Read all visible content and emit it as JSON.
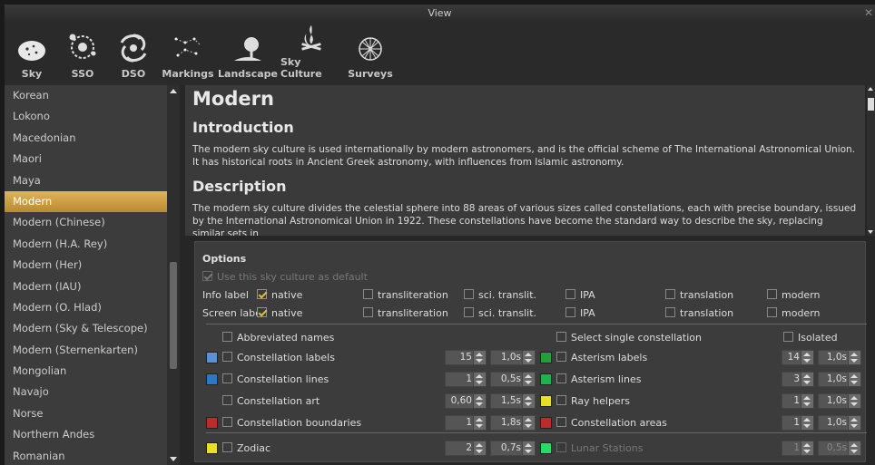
{
  "window": {
    "title": "View"
  },
  "toolbar": [
    {
      "label": "Sky",
      "icon": "sky-icon"
    },
    {
      "label": "SSO",
      "icon": "solar-system-icon"
    },
    {
      "label": "DSO",
      "icon": "galaxy-icon"
    },
    {
      "label": "Markings",
      "icon": "constellation-markings-icon"
    },
    {
      "label": "Landscape",
      "icon": "landscape-tree-icon"
    },
    {
      "label": "Sky Culture",
      "icon": "campfire-icon"
    },
    {
      "label": "Surveys",
      "icon": "geodesic-sphere-icon"
    }
  ],
  "sidebar": {
    "items": [
      "Korean",
      "Lokono",
      "Macedonian",
      "Maori",
      "Maya",
      "Modern",
      "Modern (Chinese)",
      "Modern (H.A. Rey)",
      "Modern (Her)",
      "Modern (IAU)",
      "Modern (O. Hlad)",
      "Modern (Sky & Telescope)",
      "Modern (Sternenkarten)",
      "Mongolian",
      "Navajo",
      "Norse",
      "Northern Andes",
      "Romanian"
    ],
    "selected": "Modern"
  },
  "content": {
    "title": "Modern",
    "intro_heading": "Introduction",
    "intro_text": "The modern sky culture is used internationally by modern astronomers, and is the official scheme of The International Astronomical Union. It has historical roots in Ancient Greek astronomy, with influences from Islamic astronomy.",
    "desc_heading": "Description",
    "desc_text": "The modern sky culture divides the celestial sphere into 88 areas of various sizes called constellations, each with precise boundary, issued by the International Astronomical Union in 1922. These constellations have become the standard way to describe the sky, replacing similar sets in"
  },
  "options": {
    "title": "Options",
    "use_default": "Use this sky culture as default",
    "info_label": "Info label",
    "screen_label": "Screen label",
    "label_choices": [
      "native",
      "transliteration",
      "sci. translit.",
      "IPA",
      "translation",
      "modern"
    ],
    "abbreviated_names": "Abbreviated names",
    "select_single": "Select single constellation",
    "isolated": "Isolated",
    "rows": [
      {
        "label": "Constellation labels",
        "color": "#5b8fd6",
        "value": "15",
        "fade": "1,0s",
        "a_color": "#1fa03a",
        "a_label": "Asterism labels",
        "a_value": "14",
        "a_fade": "1,0s"
      },
      {
        "label": "Constellation lines",
        "color": "#2a78c8",
        "value": "1",
        "fade": "0,5s",
        "a_color": "#1fb050",
        "a_label": "Asterism lines",
        "a_value": "3",
        "a_fade": "1,0s"
      },
      {
        "label": "Constellation art",
        "color": "",
        "value": "0,60",
        "fade": "1,5s",
        "a_color": "#e8e020",
        "a_label": "Ray helpers",
        "a_value": "1",
        "a_fade": "1,0s"
      },
      {
        "label": "Constellation boundaries",
        "color": "#b82c2c",
        "value": "1",
        "fade": "1,8s",
        "a_color": "#b82c2c",
        "a_label": "Constellation areas",
        "a_value": "1",
        "a_fade": "1,0s"
      },
      {
        "label": "Zodiac",
        "color": "#e8e020",
        "value": "2",
        "fade": "0,7s",
        "a_color": "#22dd66",
        "a_label": "Lunar Stations",
        "a_value": "1",
        "a_fade": "0,5s"
      }
    ]
  }
}
